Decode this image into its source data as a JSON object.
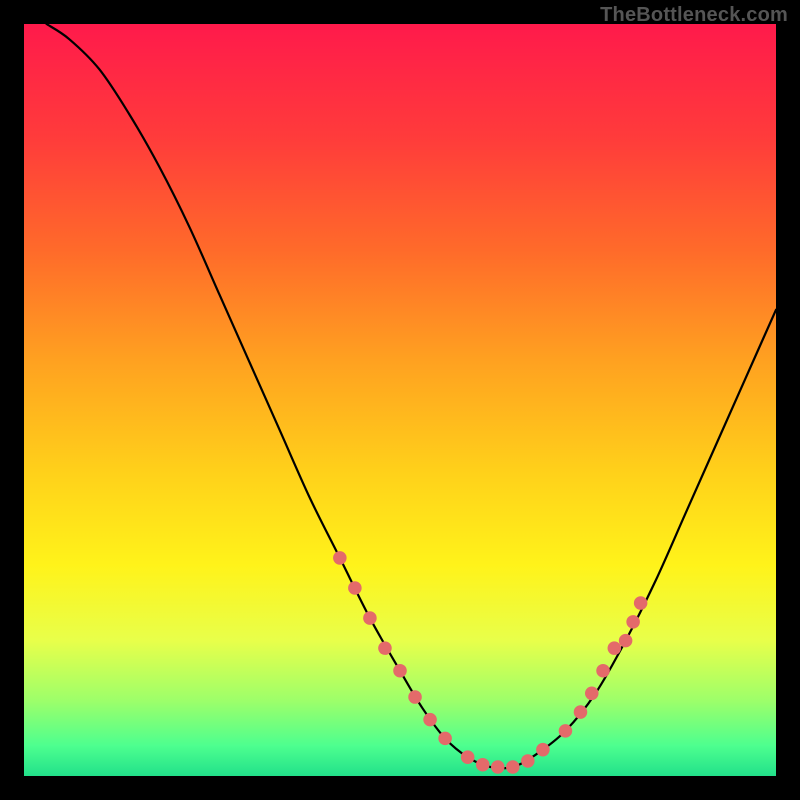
{
  "watermark": "TheBottleneck.com",
  "chart_data": {
    "type": "line",
    "title": "",
    "xlabel": "",
    "ylabel": "",
    "xlim": [
      0,
      100
    ],
    "ylim": [
      0,
      100
    ],
    "grid": false,
    "legend": false,
    "background_gradient": {
      "stops": [
        {
          "offset": 0.0,
          "color": "#ff1a4b"
        },
        {
          "offset": 0.15,
          "color": "#ff3b3b"
        },
        {
          "offset": 0.3,
          "color": "#ff6a2a"
        },
        {
          "offset": 0.45,
          "color": "#ffa220"
        },
        {
          "offset": 0.6,
          "color": "#ffd21a"
        },
        {
          "offset": 0.72,
          "color": "#fff31a"
        },
        {
          "offset": 0.82,
          "color": "#e8ff4a"
        },
        {
          "offset": 0.9,
          "color": "#9dff6a"
        },
        {
          "offset": 0.96,
          "color": "#4dff8f"
        },
        {
          "offset": 1.0,
          "color": "#22e08a"
        }
      ]
    },
    "series": [
      {
        "name": "bottleneck-curve",
        "color": "#000000",
        "x": [
          3,
          6,
          10,
          14,
          18,
          22,
          26,
          30,
          34,
          38,
          42,
          46,
          50,
          53,
          56,
          59,
          62,
          65,
          68,
          72,
          76,
          80,
          84,
          88,
          92,
          96,
          100
        ],
        "y": [
          100,
          98,
          94,
          88,
          81,
          73,
          64,
          55,
          46,
          37,
          29,
          21,
          14,
          9,
          5,
          2.5,
          1.2,
          1.2,
          2.8,
          6,
          11,
          18,
          26,
          35,
          44,
          53,
          62
        ]
      }
    ],
    "highlight_points": {
      "name": "sample-dots",
      "color": "#e46a6a",
      "radius_pct": 0.9,
      "points": [
        {
          "x": 42,
          "y": 29
        },
        {
          "x": 44,
          "y": 25
        },
        {
          "x": 46,
          "y": 21
        },
        {
          "x": 48,
          "y": 17
        },
        {
          "x": 50,
          "y": 14
        },
        {
          "x": 52,
          "y": 10.5
        },
        {
          "x": 54,
          "y": 7.5
        },
        {
          "x": 56,
          "y": 5
        },
        {
          "x": 59,
          "y": 2.5
        },
        {
          "x": 61,
          "y": 1.5
        },
        {
          "x": 63,
          "y": 1.2
        },
        {
          "x": 65,
          "y": 1.2
        },
        {
          "x": 67,
          "y": 2
        },
        {
          "x": 69,
          "y": 3.5
        },
        {
          "x": 72,
          "y": 6
        },
        {
          "x": 74,
          "y": 8.5
        },
        {
          "x": 75.5,
          "y": 11
        },
        {
          "x": 77,
          "y": 14
        },
        {
          "x": 78.5,
          "y": 17
        },
        {
          "x": 80,
          "y": 18
        },
        {
          "x": 81,
          "y": 20.5
        },
        {
          "x": 82,
          "y": 23
        }
      ]
    }
  }
}
